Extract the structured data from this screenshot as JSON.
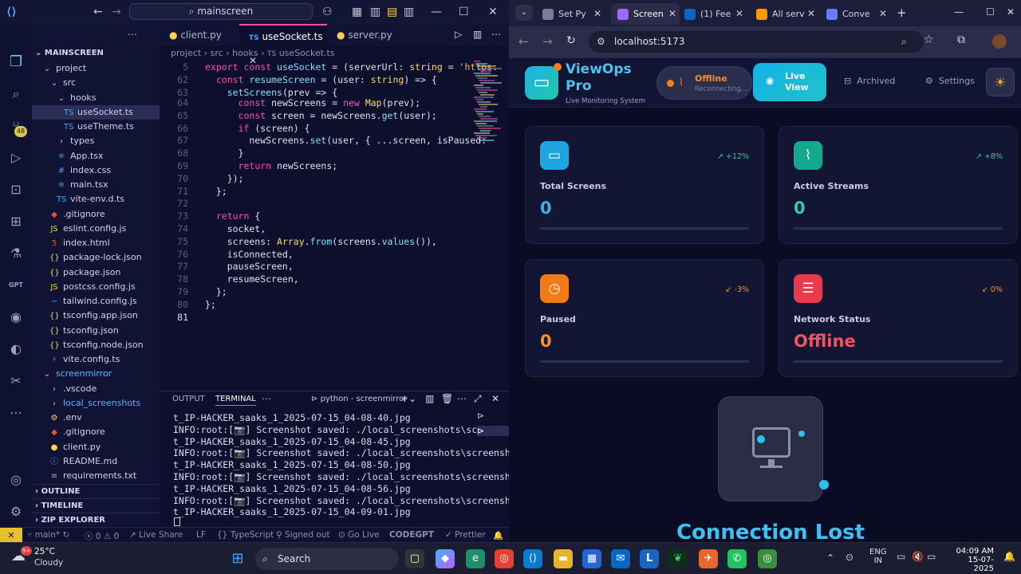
{
  "vscode": {
    "search": "mainscreen",
    "explorer": {
      "root": "MAINSCREEN",
      "items": [
        {
          "label": "project",
          "icon": "chevron-down-icon",
          "depth": 1
        },
        {
          "label": "src",
          "icon": "chevron-down-icon",
          "depth": 2
        },
        {
          "label": "hooks",
          "icon": "chevron-down-icon",
          "depth": 3
        },
        {
          "label": "useSocket.ts",
          "icon": "ts-file-icon",
          "depth": 4,
          "selected": true
        },
        {
          "label": "useTheme.ts",
          "icon": "ts-file-icon",
          "depth": 4
        },
        {
          "label": "types",
          "icon": "chevron-right-icon",
          "depth": 3
        },
        {
          "label": "App.tsx",
          "icon": "react-file-icon",
          "depth": 3
        },
        {
          "label": "index.css",
          "icon": "css-file-icon",
          "depth": 3
        },
        {
          "label": "main.tsx",
          "icon": "react-file-icon",
          "depth": 3
        },
        {
          "label": "vite-env.d.ts",
          "icon": "ts-file-icon",
          "depth": 3
        },
        {
          "label": ".gitignore",
          "icon": "git-file-icon",
          "depth": 2
        },
        {
          "label": "eslint.config.js",
          "icon": "js-file-icon",
          "depth": 2
        },
        {
          "label": "index.html",
          "icon": "html-file-icon",
          "depth": 2
        },
        {
          "label": "package-lock.json",
          "icon": "json-file-icon",
          "depth": 2
        },
        {
          "label": "package.json",
          "icon": "json-file-icon",
          "depth": 2
        },
        {
          "label": "postcss.config.js",
          "icon": "js-file-icon",
          "depth": 2
        },
        {
          "label": "tailwind.config.js",
          "icon": "tailwind-file-icon",
          "depth": 2
        },
        {
          "label": "tsconfig.app.json",
          "icon": "json-file-icon",
          "depth": 2
        },
        {
          "label": "tsconfig.json",
          "icon": "json-file-icon",
          "depth": 2
        },
        {
          "label": "tsconfig.node.json",
          "icon": "json-file-icon",
          "depth": 2
        },
        {
          "label": "vite.config.ts",
          "icon": "vite-file-icon",
          "depth": 2
        },
        {
          "label": "screenmirror",
          "icon": "chevron-down-icon",
          "depth": 1
        },
        {
          "label": ".vscode",
          "icon": "chevron-right-icon",
          "depth": 2
        },
        {
          "label": "local_screenshots",
          "icon": "chevron-right-icon",
          "depth": 2
        },
        {
          "label": ".env",
          "icon": "env-file-icon",
          "depth": 2
        },
        {
          "label": ".gitignore",
          "icon": "git-file-icon",
          "depth": 2
        },
        {
          "label": "client.py",
          "icon": "python-file-icon",
          "depth": 2
        },
        {
          "label": "README.md",
          "icon": "info-file-icon",
          "depth": 2
        },
        {
          "label": "requirements.txt",
          "icon": "txt-file-icon",
          "depth": 2
        }
      ],
      "sections": [
        "OUTLINE",
        "TIMELINE",
        "ZIP EXPLORER"
      ]
    },
    "tabs": [
      "client.py",
      "useSocket.ts",
      "server.py"
    ],
    "breadcrumb": [
      "project",
      "src",
      "hooks",
      "useSocket.ts"
    ],
    "sticky_lines": [
      {
        "n": "5",
        "text": "export const useSocket = (serverUrl: string = 'https:"
      },
      {
        "n": "62",
        "text": "  const resumeScreen = (user: string) => {"
      },
      {
        "n": "63",
        "text": "    setScreens(prev => {"
      }
    ],
    "code_lines": [
      {
        "n": "64",
        "text": "      const newScreens = new Map(prev);"
      },
      {
        "n": "65",
        "text": "      const screen = newScreens.get(user);"
      },
      {
        "n": "66",
        "text": "      if (screen) {"
      },
      {
        "n": "67",
        "text": "        newScreens.set(user, { ...screen, isPaused:"
      },
      {
        "n": "68",
        "text": "      }"
      },
      {
        "n": "69",
        "text": "      return newScreens;"
      },
      {
        "n": "70",
        "text": "    });"
      },
      {
        "n": "71",
        "text": "  };"
      },
      {
        "n": "72",
        "text": ""
      },
      {
        "n": "73",
        "text": "  return {"
      },
      {
        "n": "74",
        "text": "    socket,"
      },
      {
        "n": "75",
        "text": "    screens: Array.from(screens.values()),"
      },
      {
        "n": "76",
        "text": "    isConnected,"
      },
      {
        "n": "77",
        "text": "    pauseScreen,"
      },
      {
        "n": "78",
        "text": "    resumeScreen,"
      },
      {
        "n": "79",
        "text": "  };"
      },
      {
        "n": "80",
        "text": "};"
      },
      {
        "n": "81",
        "text": ""
      }
    ],
    "panel": {
      "tabs": [
        "OUTPUT",
        "TERMINAL"
      ],
      "terminal_name": "python - screenmirror",
      "lines": [
        "t_IP-HACKER_saaks_1_2025-07-15_04-08-40.jpg",
        "INFO:root:[📷] Screenshot saved: ./local_screenshots\\screensho",
        "t_IP-HACKER_saaks_1_2025-07-15_04-08-45.jpg",
        "INFO:root:[📷] Screenshot saved: ./local_screenshots\\screensho",
        "t_IP-HACKER_saaks_1_2025-07-15_04-08-50.jpg",
        "INFO:root:[📷] Screenshot saved: ./local_screenshots\\screensho",
        "t_IP-HACKER_saaks_1_2025-07-15_04-08-56.jpg",
        "INFO:root:[📷] Screenshot saved: ./local_screenshots\\screensho",
        "t_IP-HACKER_saaks_1_2025-07-15_04-09-01.jpg"
      ]
    },
    "status": {
      "branch": "main*",
      "errors": "0",
      "warnings": "0",
      "live_share": "Live Share",
      "eol": "LF",
      "language": "TypeScript",
      "signed": "Signed out",
      "go_live": "Go Live",
      "codegpt": "CODEGPT",
      "prettier": "Prettier"
    },
    "badge_count": "48"
  },
  "browser": {
    "tabs": [
      {
        "label": "Set Py",
        "fav": "#7a7c9a"
      },
      {
        "label": "Screen",
        "fav": "#9b6bff",
        "active": true
      },
      {
        "label": "(1) Fee",
        "fav": "#0a66c2"
      },
      {
        "label": "All serv",
        "fav": "#ff9900"
      },
      {
        "label": "Conve",
        "fav": "#6b7cff"
      }
    ],
    "url": "localhost:5173",
    "app": {
      "brand": "ViewOps Pro",
      "subtitle": "Live Monitoring System",
      "status": "Offline",
      "status_sub": "Reconnecting...",
      "nav": [
        {
          "label": "Live View",
          "icon": "eye-icon"
        },
        {
          "label": "Archived",
          "icon": "archive-icon"
        },
        {
          "label": "Settings",
          "icon": "gear-icon"
        }
      ],
      "cards": [
        {
          "label": "Total Screens",
          "value": "0",
          "trend": "+12%",
          "icon": "monitor-icon",
          "color": "#1ea5e0",
          "valcolor": "#36b3ee",
          "trendcolor": "#2fc8a0"
        },
        {
          "label": "Active Streams",
          "value": "0",
          "trend": "+8%",
          "icon": "activity-icon",
          "color": "#14a88e",
          "valcolor": "#2bd0b0",
          "trendcolor": "#2fc8a0"
        },
        {
          "label": "Paused",
          "value": "0",
          "trend": "-3%",
          "icon": "clock-icon",
          "color": "#f27b16",
          "valcolor": "#f5902a",
          "trendcolor": "#f5902a"
        },
        {
          "label": "Network Status",
          "value": "Offline",
          "trend": "0%",
          "icon": "database-icon",
          "color": "#e83b4a",
          "valcolor": "#f0545e",
          "trendcolor": "#f5902a"
        }
      ],
      "connection": "Connection Lost"
    }
  },
  "taskbar": {
    "weather_temp": "25°C",
    "weather_desc": "Cloudy",
    "weather_badge": "9+",
    "search": "Search",
    "lang1": "ENG",
    "lang2": "IN",
    "time": "04:09 AM",
    "date": "15-07-2025"
  }
}
